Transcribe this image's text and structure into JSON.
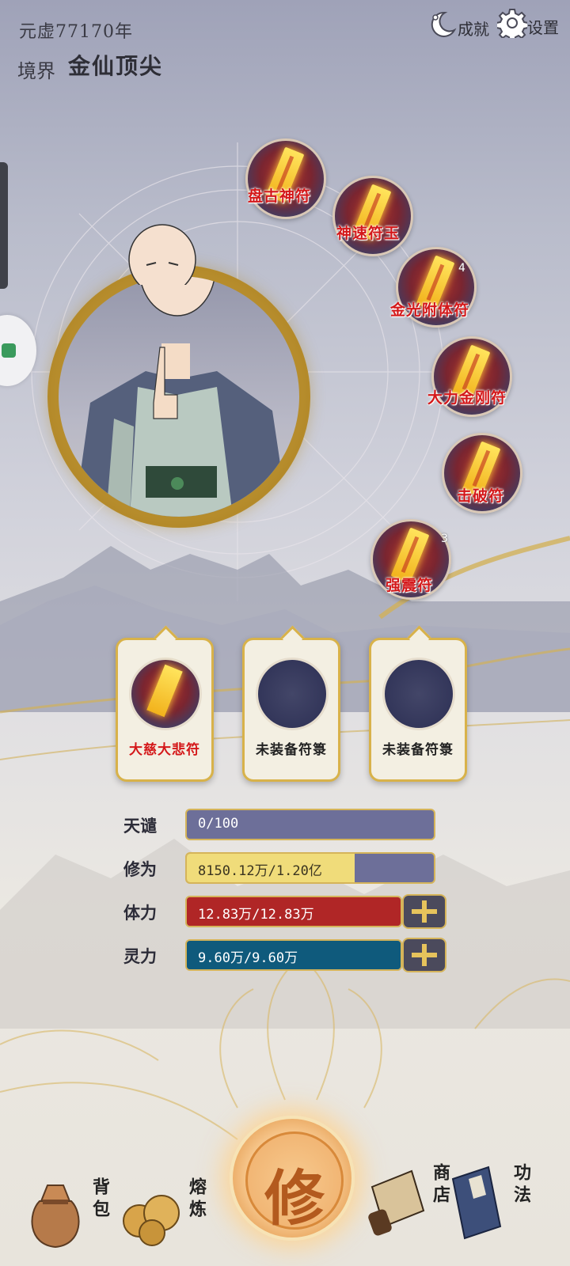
{
  "header": {
    "era": "元虚77170年",
    "realm_label": "境界",
    "realm_value": "金仙顶尖",
    "achievement_label": "成就",
    "settings_label": "设置"
  },
  "talismans": [
    {
      "name": "盘古神符",
      "count": ""
    },
    {
      "name": "神速符玉",
      "count": ""
    },
    {
      "name": "金光附体符",
      "count": "4"
    },
    {
      "name": "大力金刚符",
      "count": ""
    },
    {
      "name": "击破符",
      "count": ""
    },
    {
      "name": "强震符",
      "count": "3"
    }
  ],
  "slots": [
    {
      "label": "大慈大悲符",
      "equipped": true
    },
    {
      "label": "未装备符箓",
      "equipped": false
    },
    {
      "label": "未装备符箓",
      "equipped": false
    }
  ],
  "stats": [
    {
      "label": "天谴",
      "value": "0/100",
      "fill": 0.0,
      "color": "#6d6f99",
      "plus": false
    },
    {
      "label": "修为",
      "value": "8150.12万/1.20亿",
      "fill": 0.68,
      "color": "#f0dc7a",
      "plus": false
    },
    {
      "label": "体力",
      "value": "12.83万/12.83万",
      "fill": 1.0,
      "color": "#b02626",
      "plus": true
    },
    {
      "label": "灵力",
      "value": "9.60万/9.60万",
      "fill": 1.0,
      "color": "#0f5a7c",
      "plus": true
    }
  ],
  "nav": {
    "bag": "背包",
    "refine": "熔炼",
    "cultivate": "修",
    "shop": "商店",
    "skills": "功法"
  }
}
